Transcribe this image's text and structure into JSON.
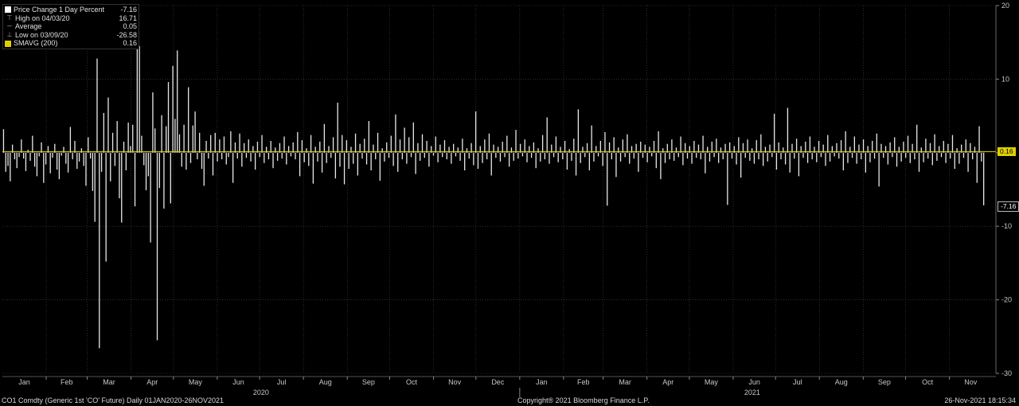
{
  "legend": {
    "series_label": "Price Change 1 Day Percent",
    "series_value": "-7.16",
    "high_label": "High on 04/03/20",
    "high_value": "16.71",
    "average_label": "Average",
    "average_value": "0.05",
    "low_label": "Low on 03/09/20",
    "low_value": "-26.58",
    "smavg_label": "SMAVG (200)",
    "smavg_value": "0.16"
  },
  "footer": {
    "left": "CO1 Comdty (Generic 1st 'CO' Future)  Daily 01JAN2020-26NOV2021",
    "center": "Copyright® 2021 Bloomberg Finance L.P.",
    "right": "26-Nov-2021 18:15:34"
  },
  "callouts": {
    "smavg": "0.16",
    "last": "-7.16"
  },
  "colors": {
    "bars": "#e8e8e8",
    "smavg": "#e0d000",
    "grid": "#4a4a4a",
    "background": "#000000"
  },
  "chart_data": {
    "type": "bar",
    "series_name": "Price Change 1 Day Percent",
    "x_range": [
      "2020-01-01",
      "2021-11-26"
    ],
    "ylim": [
      -30,
      20
    ],
    "yticks": [
      20,
      10,
      0,
      -10,
      -20,
      -30
    ],
    "ytick_labels": [
      "20",
      "10",
      "0",
      "-10",
      "-20",
      "-30"
    ],
    "month_labels": [
      "Jan",
      "Feb",
      "Mar",
      "Apr",
      "May",
      "Jun",
      "Jul",
      "Aug",
      "Sep",
      "Oct",
      "Nov",
      "Dec",
      "Jan",
      "Feb",
      "Mar",
      "Apr",
      "May",
      "Jun",
      "Jul",
      "Aug",
      "Sep",
      "Oct",
      "Nov"
    ],
    "year_labels": [
      "2020",
      "2021"
    ],
    "grid": true,
    "overlay": {
      "name": "SMAVG (200)",
      "last_value": 0.16
    },
    "last_value": -7.16,
    "notable_points": [
      {
        "date": "2020-03-09",
        "value": -26.58
      },
      {
        "date": "2020-04-03",
        "value": 16.71
      },
      {
        "date": "2021-11-26",
        "value": -7.16
      }
    ],
    "daily_values": [
      3.2,
      -2.6,
      -1.8,
      -3.9,
      1.1,
      -0.9,
      -2.1,
      -0.6,
      1.8,
      -0.8,
      -2.5,
      0.4,
      -1.1,
      2.3,
      -1.9,
      -3.2,
      -0.5,
      1.4,
      -4.1,
      -1.6,
      0.9,
      -2.8,
      -0.7,
      1.2,
      -2.3,
      -3.6,
      -0.4,
      0.8,
      -1.5,
      -2.7,
      3.5,
      -0.9,
      1.6,
      -2.2,
      -1.2,
      0.6,
      -1.8,
      -4.5,
      2.1,
      -0.8,
      -5.2,
      -9.4,
      12.8,
      -26.58,
      -2.6,
      5.4,
      -14.8,
      7.5,
      -3.9,
      2.7,
      -1.8,
      4.3,
      -6.2,
      -9.5,
      1.5,
      -2.4,
      4.1,
      0.9,
      3.8,
      -7.3,
      16.71,
      14.5,
      2.3,
      -1.7,
      -5.1,
      -3.2,
      -12.2,
      8.2,
      3.3,
      -25.5,
      -4.8,
      5.1,
      -7.6,
      3.6,
      9.6,
      -6.9,
      11.8,
      4.6,
      13.9,
      2.5,
      -1.9,
      3.8,
      -2.3,
      8.9,
      -1.4,
      3.7,
      5.6,
      -0.9,
      2.7,
      -2.2,
      -4.5,
      1.6,
      -0.8,
      2.4,
      -3.1,
      2.7,
      -1.2,
      1.8,
      -0.9,
      2.2,
      -1.6,
      -0.6,
      2.9,
      -4.1,
      1.4,
      -0.8,
      2.6,
      -1.9,
      1.3,
      -0.7,
      1.8,
      -1.2,
      0.9,
      -2.3,
      1.5,
      -0.6,
      2.4,
      -1.4,
      0.8,
      -0.9,
      1.6,
      -2.1,
      0.7,
      -1.1,
      1.3,
      -0.8,
      2.2,
      -1.6,
      0.9,
      -0.5,
      1.4,
      -0.9,
      2.8,
      -3.2,
      1.7,
      -1.3,
      0.6,
      -1.8,
      2.4,
      -4.2,
      0.8,
      -1.2,
      1.5,
      -2.7,
      3.9,
      -1.4,
      0.9,
      -0.7,
      2.1,
      -3.5,
      6.8,
      -1.9,
      2.4,
      -4.3,
      1.7,
      -2.2,
      0.8,
      -1.5,
      2.6,
      -3.1,
      1.2,
      -0.8,
      1.9,
      -1.6,
      4.3,
      -2.4,
      1.1,
      -0.9,
      2.7,
      -3.8,
      0.6,
      -1.2,
      1.4,
      -0.7,
      2.3,
      -1.8,
      5.2,
      -2.6,
      1.8,
      -0.9,
      3.4,
      -1.5,
      2.1,
      -0.6,
      4.1,
      -2.9,
      1.3,
      -1.1,
      2.5,
      -0.7,
      1.6,
      -1.9,
      0.9,
      -0.4,
      2.2,
      -1.3,
      1.1,
      -0.6,
      1.7,
      -0.9,
      0.8,
      -1.5,
      1.2,
      -0.5,
      0.7,
      -1.1,
      1.9,
      -2.4,
      0.6,
      -0.8,
      1.3,
      -1.7,
      5.6,
      -2.2,
      0.9,
      -1.4,
      1.8,
      -0.9,
      2.6,
      -3.1,
      1.1,
      -0.7,
      0.8,
      -1.2,
      1.5,
      -0.6,
      2.3,
      -1.9,
      0.7,
      -1.1,
      3.1,
      -0.8,
      1.2,
      -0.5,
      1.8,
      -1.3,
      0.9,
      -0.7,
      1.4,
      -2.1,
      0.6,
      -1.2,
      2.4,
      -0.9,
      4.8,
      -1.5,
      1.1,
      -0.6,
      2.2,
      -1.3,
      0.8,
      -0.9,
      1.6,
      -2.3,
      0.5,
      -1.1,
      1.9,
      -3.1,
      5.9,
      -1.4,
      0.8,
      -0.6,
      1.3,
      -2.4,
      3.7,
      -1.2,
      0.9,
      -0.5,
      1.6,
      -1.8,
      2.8,
      -7.2,
      1.4,
      -0.9,
      2.1,
      -3.3,
      0.7,
      -1.2,
      1.8,
      -0.6,
      2.5,
      -1.5,
      0.9,
      -0.8,
      1.2,
      -2.6,
      1.5,
      -0.7,
      1.1,
      -1.3,
      0.8,
      -0.5,
      1.6,
      -2.1,
      2.9,
      -3.6,
      0.6,
      -1.4,
      1.2,
      -0.9,
      1.8,
      -1.1,
      0.7,
      -0.6,
      2.2,
      -1.7,
      1.3,
      -0.8,
      0.9,
      -1.5,
      1.6,
      -0.7,
      1.1,
      -0.9,
      2.3,
      -2.8,
      0.8,
      -1.2,
      1.5,
      -0.6,
      1.9,
      -1.4,
      0.7,
      -0.9,
      1.2,
      -7.1,
      1.4,
      -0.8,
      0.9,
      -1.6,
      2.1,
      -3.4,
      1.3,
      -0.7,
      1.8,
      -1.1,
      0.6,
      -1.5,
      1.7,
      -0.9,
      2.5,
      -1.8,
      0.8,
      -1.2,
      1.1,
      -0.6,
      5.3,
      -2.3,
      1.4,
      -0.9,
      0.7,
      -1.6,
      6.1,
      -2.7,
      1.2,
      -0.8,
      1.9,
      -3.2,
      0.9,
      -0.7,
      1.5,
      -1.4,
      2.2,
      -0.9,
      0.8,
      -1.3,
      1.6,
      -0.6,
      1.1,
      -1.8,
      2.4,
      -1.2,
      0.9,
      -0.5,
      1.3,
      -0.8,
      1.7,
      -2.4,
      2.9,
      -1.4,
      0.8,
      -0.7,
      2.2,
      -1.5,
      1.1,
      -0.9,
      1.8,
      -2.7,
      0.9,
      -1.3,
      1.6,
      -0.8,
      2.6,
      -4.6,
      1.2,
      -0.7,
      0.9,
      -1.6,
      1.4,
      -0.6,
      2.1,
      -1.9,
      0.8,
      -1.2,
      1.5,
      -0.7,
      2.3,
      -1.4,
      1.2,
      -0.9,
      3.8,
      -2.6,
      0.7,
      -1.3,
      1.9,
      -0.8,
      1.3,
      -1.7,
      2.5,
      -1.1,
      0.9,
      -0.6,
      1.6,
      -1.4,
      1.2,
      -0.8,
      2.4,
      -2.2,
      0.6,
      -1.5,
      1.1,
      -0.7,
      1.8,
      -2.6,
      1.3,
      -0.9,
      0.8,
      -4.1,
      3.6,
      -1.2,
      -7.16
    ]
  }
}
